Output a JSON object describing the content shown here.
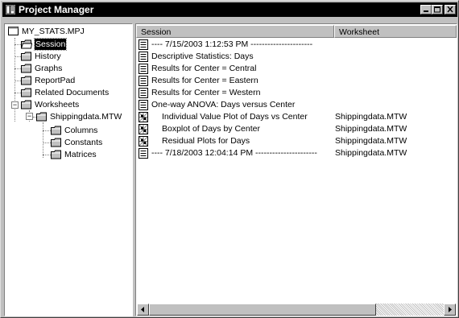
{
  "window": {
    "title": "Project Manager"
  },
  "tree": {
    "root": "MY_STATS.MPJ",
    "items": [
      "Session",
      "History",
      "Graphs",
      "ReportPad",
      "Related Documents",
      "Worksheets"
    ],
    "worksheet": "Shippingdata.MTW",
    "sub_items": [
      "Columns",
      "Constants",
      "Matrices"
    ],
    "selected": "Session"
  },
  "table": {
    "columns": [
      "Session",
      "Worksheet"
    ],
    "rows": [
      {
        "icon": "session-doc-icon",
        "session": "----   7/15/2003 1:12:53 PM   ----------------------",
        "worksheet": ""
      },
      {
        "icon": "session-doc-icon",
        "session": "Descriptive Statistics: Days",
        "worksheet": ""
      },
      {
        "icon": "session-doc-icon",
        "session": "Results for Center = Central",
        "worksheet": ""
      },
      {
        "icon": "session-doc-icon",
        "session": "Results for Center = Eastern",
        "worksheet": ""
      },
      {
        "icon": "session-doc-icon",
        "session": "Results for Center = Western",
        "worksheet": ""
      },
      {
        "icon": "session-doc-icon",
        "session": "One-way ANOVA: Days versus Center",
        "worksheet": ""
      },
      {
        "icon": "graph-icon",
        "session": "Individual Value Plot of Days vs Center",
        "worksheet": "Shippingdata.MTW"
      },
      {
        "icon": "graph-icon",
        "session": "Boxplot of Days by Center",
        "worksheet": "Shippingdata.MTW"
      },
      {
        "icon": "graph-icon",
        "session": "Residual Plots for Days",
        "worksheet": "Shippingdata.MTW"
      },
      {
        "icon": "session-doc-icon",
        "session": "----   7/18/2003 12:04:14 PM   ----------------------",
        "worksheet": "Shippingdata.MTW"
      }
    ]
  }
}
